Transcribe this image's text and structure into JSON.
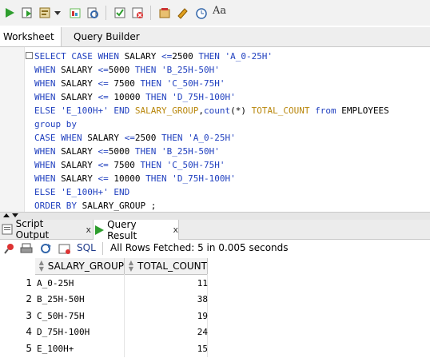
{
  "toolbar": {
    "icons": [
      "run-statement-icon",
      "run-script-icon",
      "explain-plan-icon",
      "dropdown-icon",
      "autotrace-icon",
      "sql-tuning-icon",
      "commit-icon",
      "rollback-icon",
      "sql-history-icon",
      "clear-icon",
      "sql-worksheet-timer-icon",
      "change-case-icon"
    ],
    "change_case_label": "Aa"
  },
  "worksheet_tabs": [
    "Worksheet",
    "Query Builder"
  ],
  "editor": {
    "lines": [
      [
        [
          "kw",
          "SELECT CASE WHEN "
        ],
        [
          "plain",
          "SALARY "
        ],
        [
          "kw",
          "<="
        ],
        [
          "num",
          "2500 "
        ],
        [
          "kw",
          "THEN "
        ],
        [
          "str",
          "'A_0-25H'"
        ]
      ],
      [
        [
          "kw",
          "WHEN "
        ],
        [
          "plain",
          "SALARY "
        ],
        [
          "kw",
          "<="
        ],
        [
          "num",
          "5000 "
        ],
        [
          "kw",
          "THEN "
        ],
        [
          "str",
          "'B_25H-50H'"
        ]
      ],
      [
        [
          "kw",
          "WHEN "
        ],
        [
          "plain",
          "SALARY "
        ],
        [
          "kw",
          "<= "
        ],
        [
          "num",
          "7500 "
        ],
        [
          "kw",
          "THEN "
        ],
        [
          "str",
          "'C_50H-75H'"
        ]
      ],
      [
        [
          "kw",
          "WHEN "
        ],
        [
          "plain",
          "SALARY "
        ],
        [
          "kw",
          "<= "
        ],
        [
          "num",
          "10000 "
        ],
        [
          "kw",
          "THEN "
        ],
        [
          "str",
          "'D_75H-100H'"
        ]
      ],
      [
        [
          "kw",
          "ELSE "
        ],
        [
          "str",
          "'E_100H+' "
        ],
        [
          "kw",
          "END "
        ],
        [
          "fn",
          "SALARY_GROUP"
        ],
        [
          "plain",
          ","
        ],
        [
          "kw",
          "count"
        ],
        [
          "plain",
          "(*) "
        ],
        [
          "fn",
          "TOTAL_COUNT "
        ],
        [
          "kw",
          "from "
        ],
        [
          "plain",
          "EMPLOYEES"
        ]
      ],
      [
        [
          "kw",
          "group by"
        ]
      ],
      [
        [
          "kw",
          "CASE WHEN "
        ],
        [
          "plain",
          "SALARY "
        ],
        [
          "kw",
          "<="
        ],
        [
          "num",
          "2500 "
        ],
        [
          "kw",
          "THEN "
        ],
        [
          "str",
          "'A_0-25H'"
        ]
      ],
      [
        [
          "kw",
          "WHEN "
        ],
        [
          "plain",
          "SALARY "
        ],
        [
          "kw",
          "<="
        ],
        [
          "num",
          "5000 "
        ],
        [
          "kw",
          "THEN "
        ],
        [
          "str",
          "'B_25H-50H'"
        ]
      ],
      [
        [
          "kw",
          "WHEN "
        ],
        [
          "plain",
          "SALARY "
        ],
        [
          "kw",
          "<= "
        ],
        [
          "num",
          "7500 "
        ],
        [
          "kw",
          "THEN "
        ],
        [
          "str",
          "'C_50H-75H'"
        ]
      ],
      [
        [
          "kw",
          "WHEN "
        ],
        [
          "plain",
          "SALARY "
        ],
        [
          "kw",
          "<= "
        ],
        [
          "num",
          "10000 "
        ],
        [
          "kw",
          "THEN "
        ],
        [
          "str",
          "'D_75H-100H'"
        ]
      ],
      [
        [
          "kw",
          "ELSE "
        ],
        [
          "str",
          "'E_100H+' "
        ],
        [
          "kw",
          "END"
        ]
      ],
      [
        [
          "kw",
          "ORDER BY "
        ],
        [
          "plain",
          "SALARY_GROUP ;"
        ]
      ]
    ]
  },
  "result_tabs": {
    "script_output": "Script Output",
    "query_result": "Query Result",
    "close": "x"
  },
  "results_toolbar": {
    "sql_label": "SQL",
    "status": "All Rows Fetched: 5 in 0.005 seconds"
  },
  "grid": {
    "columns": [
      "SALARY_GROUP",
      "TOTAL_COUNT"
    ],
    "rows": [
      {
        "num": "1",
        "group": "A_0-25H",
        "count": "11"
      },
      {
        "num": "2",
        "group": "B_25H-50H",
        "count": "38"
      },
      {
        "num": "3",
        "group": "C_50H-75H",
        "count": "19"
      },
      {
        "num": "4",
        "group": "D_75H-100H",
        "count": "24"
      },
      {
        "num": "5",
        "group": "E_100H+",
        "count": "15"
      }
    ]
  }
}
